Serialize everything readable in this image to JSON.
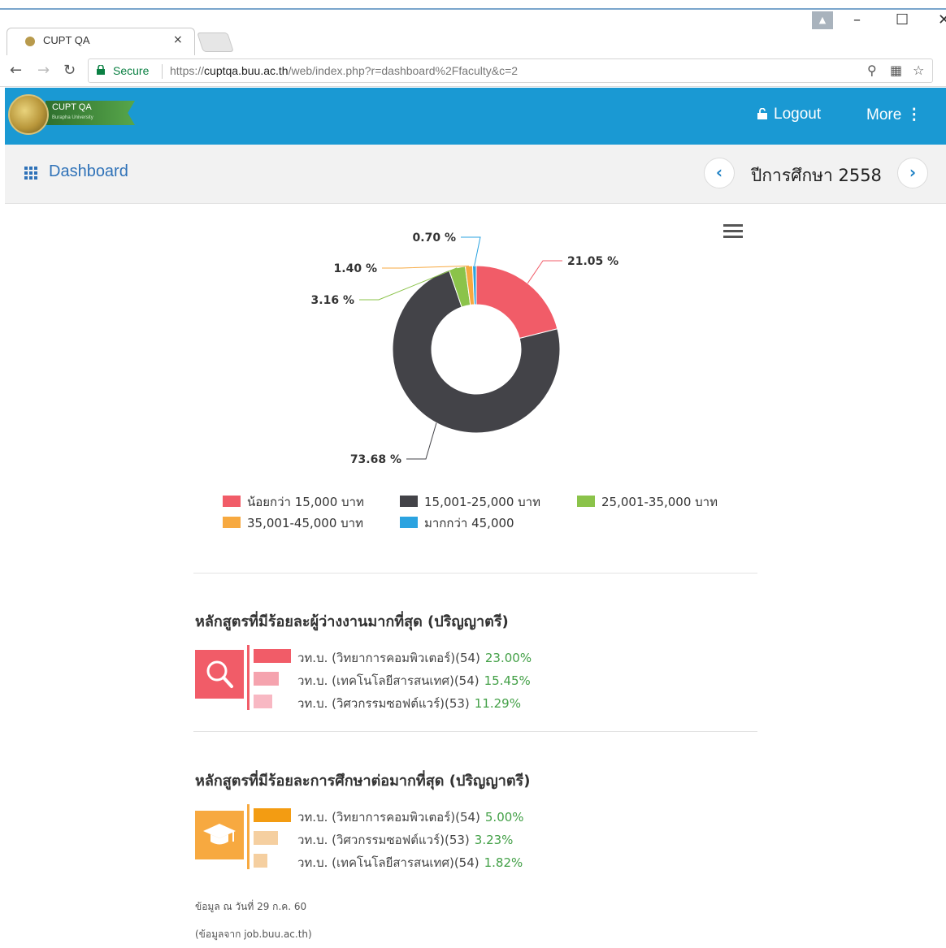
{
  "browser": {
    "tab_title": "CUPT QA",
    "tab_close": "×",
    "secure_label": "Secure",
    "url_scheme": "https://",
    "url_host": "cuptqa.buu.ac.th",
    "url_path": "/web/index.php?r=dashboard%2Ffaculty&c=2"
  },
  "navbar": {
    "logo_text": "CUPT QA",
    "logo_subtext": "Burapha University",
    "logout_label": "Logout",
    "more_label": "More"
  },
  "subbar": {
    "dashboard_label": "Dashboard",
    "year_label": "ปีการศึกษา 2558"
  },
  "chart_data": {
    "type": "pie",
    "variant": "donut",
    "slices": [
      {
        "label": "น้อยกว่า 15,000 บาท",
        "value": 21.05,
        "display": "21.05 %",
        "color": "#f15c68"
      },
      {
        "label": "15,001-25,000 บาท",
        "value": 73.68,
        "display": "73.68 %",
        "color": "#434348"
      },
      {
        "label": "25,001-35,000 บาท",
        "value": 3.16,
        "display": "3.16 %",
        "color": "#8bc34a"
      },
      {
        "label": "35,001-45,000 บาท",
        "value": 1.4,
        "display": "1.40 %",
        "color": "#f7a940"
      },
      {
        "label": "มากกว่า 45,000",
        "value": 0.7,
        "display": "0.70 %",
        "color": "#2ba3e0"
      }
    ],
    "legend_position": "bottom"
  },
  "unemployment": {
    "title": "หลักสูตรที่มีร้อยละผู้ว่างงานมากที่สุด (ปริญญาตรี)",
    "color": "#f15c68",
    "items": [
      {
        "label": "วท.บ. (วิทยาการคอมพิวเตอร์)(54)",
        "percent": "23.00%",
        "value": 23.0,
        "color": "#f15c68"
      },
      {
        "label": "วท.บ. (เทคโนโลยีสารสนเทศ)(54)",
        "percent": "15.45%",
        "value": 15.45,
        "color": "#f5a3ae"
      },
      {
        "label": "วท.บ. (วิศวกรรมซอฟต์แวร์)(53)",
        "percent": "11.29%",
        "value": 11.29,
        "color": "#f8b8c3"
      }
    ]
  },
  "further_study": {
    "title": "หลักสูตรที่มีร้อยละการศึกษาต่อมากที่สุด (ปริญญาตรี)",
    "color": "#f7a940",
    "items": [
      {
        "label": "วท.บ. (วิทยาการคอมพิวเตอร์)(54)",
        "percent": "5.00%",
        "value": 5.0,
        "color": "#f39c12"
      },
      {
        "label": "วท.บ. (วิศวกรรมซอฟต์แวร์)(53)",
        "percent": "3.23%",
        "value": 3.23,
        "color": "#f5cfa0"
      },
      {
        "label": "วท.บ. (เทคโนโลยีสารสนเทศ)(54)",
        "percent": "1.82%",
        "value": 1.82,
        "color": "#f5cfa0"
      }
    ]
  },
  "footnotes": {
    "data_date": "ข้อมูล ณ วันที่ 29 ก.ค. 60",
    "data_source": "(ข้อมูลจาก job.buu.ac.th)"
  }
}
